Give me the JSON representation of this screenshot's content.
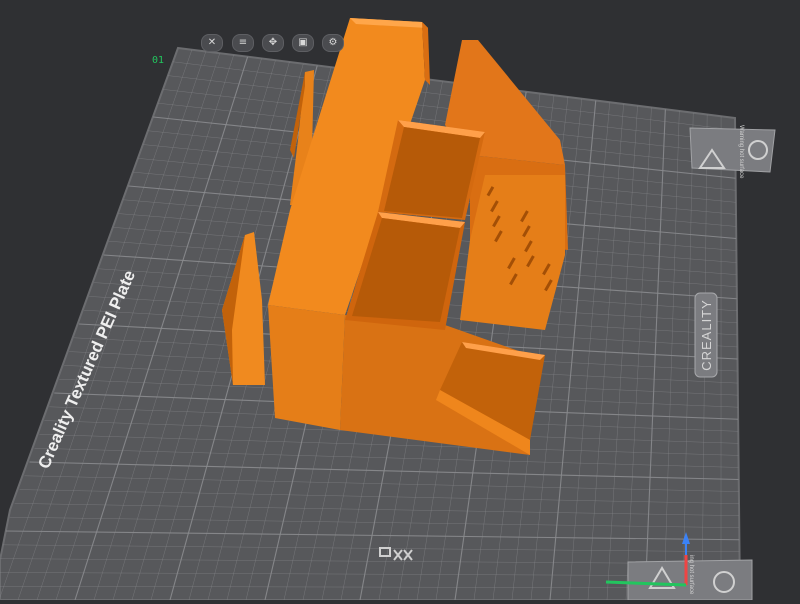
{
  "plate": {
    "index": "01",
    "name": "Creality Textured PEI Plate",
    "brand": "CREALITY",
    "warning_text": "Warning hot surface",
    "warning_text_bottom": "ing hot surface",
    "toolbar": [
      {
        "icon": "close-icon",
        "glyph": "✕"
      },
      {
        "icon": "arrange-icon",
        "glyph": "≡"
      },
      {
        "icon": "auto-orient-icon",
        "glyph": "✥"
      },
      {
        "icon": "lock-icon",
        "glyph": "▣"
      },
      {
        "icon": "settings-icon",
        "glyph": "⚙"
      }
    ]
  },
  "colors": {
    "background": "#2f3033",
    "plate": "#57585b",
    "grid": "#8a8b8e",
    "model": "#f28a1e",
    "model_shadow": "#c2620a",
    "plate_index": "#22c55e",
    "axis_x": "#ef4444",
    "axis_y": "#22c55e",
    "axis_z": "#3b82f6"
  }
}
